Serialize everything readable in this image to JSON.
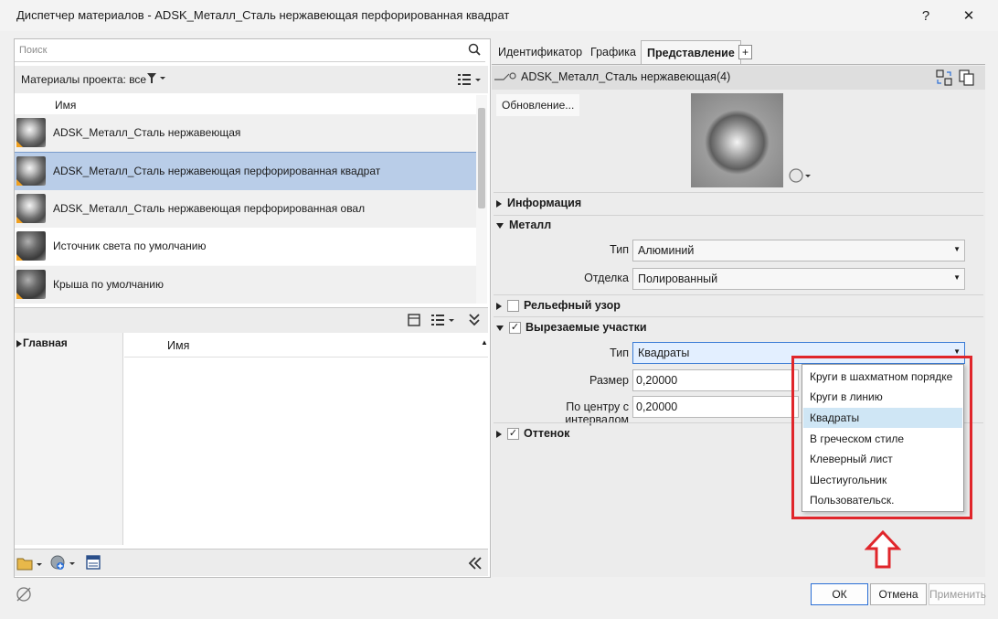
{
  "window": {
    "title": "Диспетчер материалов - ADSK_Металл_Сталь нержавеющая перфорированная квадрат",
    "help": "?",
    "close": "✕"
  },
  "left": {
    "search_placeholder": "Поиск",
    "filter_label": "Материалы проекта: все",
    "col_name": "Имя",
    "materials": [
      {
        "name": "ADSK_Металл_Сталь нержавеющая",
        "selected": false
      },
      {
        "name": "ADSK_Металл_Сталь нержавеющая перфорированная квадрат",
        "selected": true
      },
      {
        "name": "ADSK_Металл_Сталь нержавеющая перфорированная овал",
        "selected": false
      },
      {
        "name": "Источник света по умолчанию",
        "selected": false
      },
      {
        "name": "Крыша по умолчанию",
        "selected": false
      }
    ],
    "tree_root": "Главная",
    "lib_col_name": "Имя"
  },
  "right": {
    "tabs": [
      "Идентификатор",
      "Графика",
      "Представление",
      "+"
    ],
    "active_tab": "Представление",
    "asset_name": "ADSK_Металл_Сталь нержавеющая(4)",
    "update_button": "Обновление...",
    "sections": {
      "info": "Информация",
      "metal": "Металл",
      "relief": "Рельефный узор",
      "cutouts": "Вырезаемые участки",
      "tint": "Оттенок"
    },
    "metal": {
      "type_label": "Тип",
      "type_value": "Алюминий",
      "finish_label": "Отделка",
      "finish_value": "Полированный"
    },
    "cutouts": {
      "type_label": "Тип",
      "type_value": "Квадраты",
      "size_label": "Размер",
      "size_value": "0,20000",
      "spacing_label": "По центру с интервалом",
      "spacing_value": "0,20000"
    },
    "dropdown_options": [
      "Круги в шахматном порядке",
      "Круги в линию",
      "Квадраты",
      "В греческом стиле",
      "Клеверный лист",
      "Шестиугольник",
      "Пользовательск."
    ],
    "dropdown_selected_index": 2
  },
  "footer": {
    "ok": "ОК",
    "cancel": "Отмена",
    "apply": "Применить"
  },
  "colors": {
    "highlight": "#e0262b",
    "selection": "#b9cde8"
  }
}
